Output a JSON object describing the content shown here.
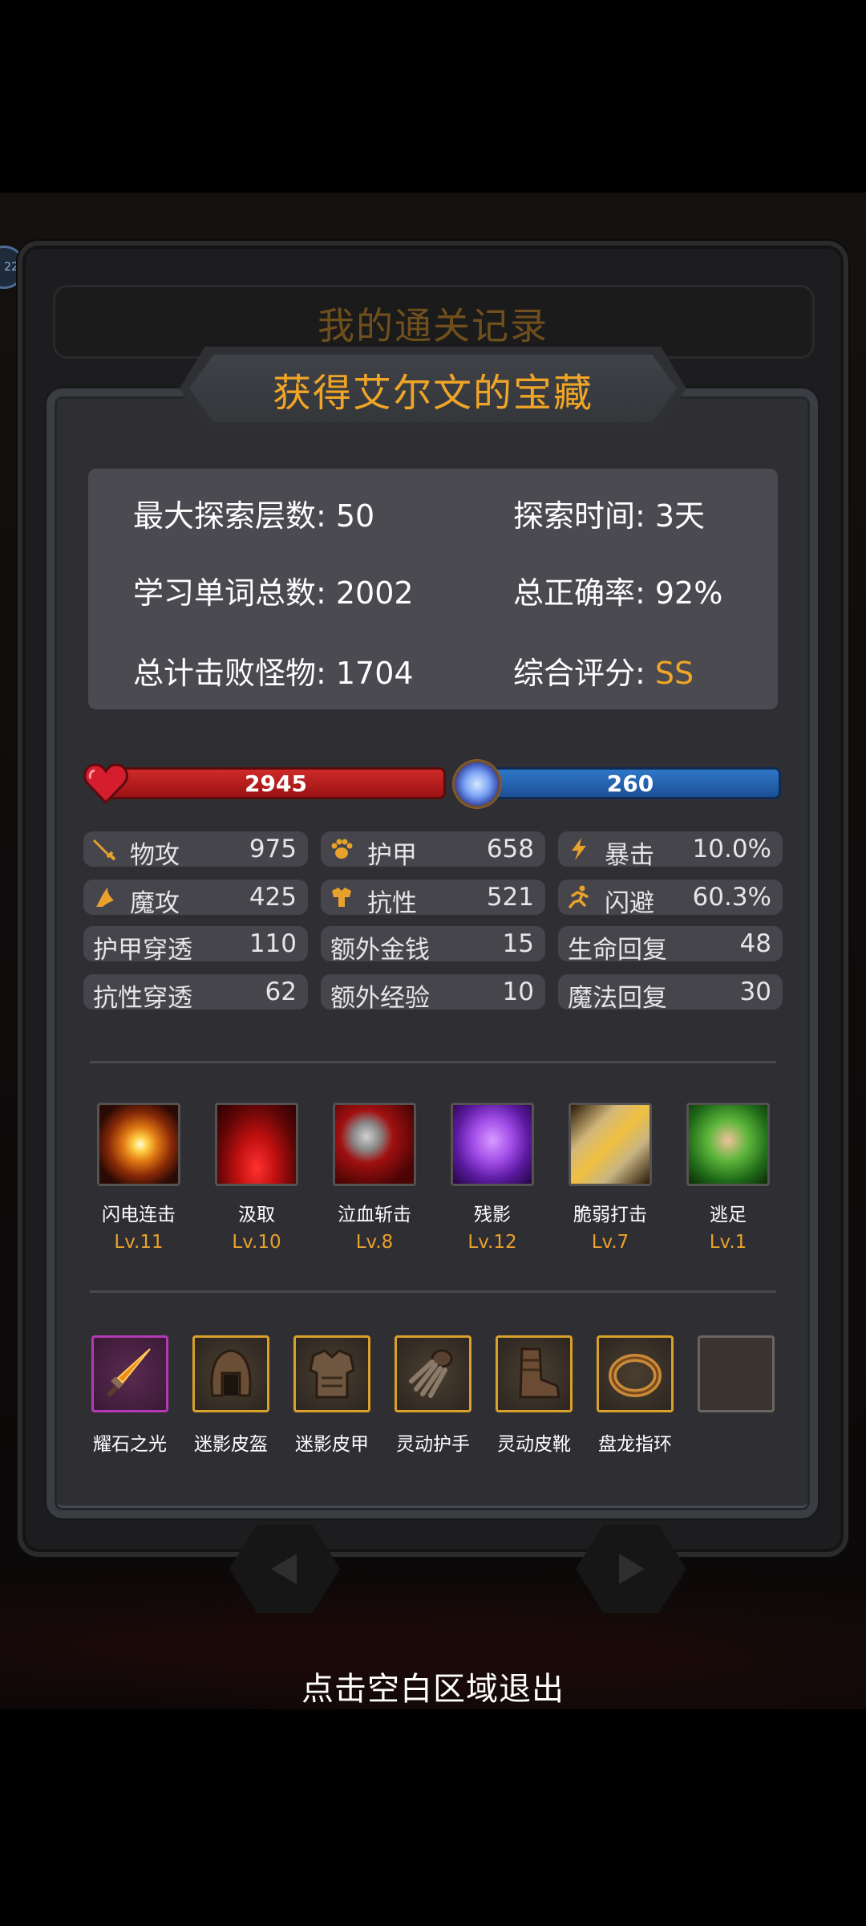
{
  "side_badge": "22",
  "back_title": "我的通关记录",
  "title": "获得艾尔文的宝藏",
  "summary": {
    "max_floor": "最大探索层数: 50",
    "explore_time": "探索时间: 3天",
    "words_total": "学习单词总数: 2002",
    "accuracy": "总正确率: 92%",
    "monsters": "总计击败怪物: 1704",
    "rating_label": "综合评分: ",
    "rating_value": "SS"
  },
  "hp": "2945",
  "mp": "260",
  "stats": [
    {
      "label": "物攻",
      "value": "975",
      "icon": "sword-icon"
    },
    {
      "label": "护甲",
      "value": "658",
      "icon": "paw-icon"
    },
    {
      "label": "暴击",
      "value": "10.0%",
      "icon": "lightning-icon"
    },
    {
      "label": "魔攻",
      "value": "425",
      "icon": "magic-hat-icon"
    },
    {
      "label": "抗性",
      "value": "521",
      "icon": "armor-icon"
    },
    {
      "label": "闪避",
      "value": "60.3%",
      "icon": "running-icon"
    },
    {
      "label": "护甲穿透",
      "value": "110"
    },
    {
      "label": "额外金钱",
      "value": "15"
    },
    {
      "label": "生命回复",
      "value": "48"
    },
    {
      "label": "抗性穿透",
      "value": "62"
    },
    {
      "label": "额外经验",
      "value": "10"
    },
    {
      "label": "魔法回复",
      "value": "30"
    }
  ],
  "skills": [
    {
      "name": "闪电连击",
      "level": "Lv.11",
      "icon": "lightning-strike-icon"
    },
    {
      "name": "汲取",
      "level": "Lv.10",
      "icon": "blood-drain-icon"
    },
    {
      "name": "泣血斩击",
      "level": "Lv.8",
      "icon": "bloody-axe-icon"
    },
    {
      "name": "残影",
      "level": "Lv.12",
      "icon": "shadow-figure-icon"
    },
    {
      "name": "脆弱打击",
      "level": "Lv.7",
      "icon": "broken-bone-icon"
    },
    {
      "name": "逃足",
      "level": "Lv.1",
      "icon": "winged-foot-icon"
    }
  ],
  "equipment": [
    {
      "name": "耀石之光",
      "icon": "dagger-icon",
      "rarity": "#b43ab4"
    },
    {
      "name": "迷影皮盔",
      "icon": "helmet-icon",
      "rarity": "#d9a12b"
    },
    {
      "name": "迷影皮甲",
      "icon": "chest-armor-icon",
      "rarity": "#d9a12b"
    },
    {
      "name": "灵动护手",
      "icon": "gauntlet-icon",
      "rarity": "#d9a12b"
    },
    {
      "name": "灵动皮靴",
      "icon": "boots-icon",
      "rarity": "#d9a12b"
    },
    {
      "name": "盘龙指环",
      "icon": "ring-icon",
      "rarity": "#d9a12b"
    },
    {
      "name": "",
      "icon": "empty-slot-icon",
      "rarity": "#6a6561"
    }
  ],
  "exit_hint": "点击空白区域退出",
  "colors": {
    "gold": "#f0a526",
    "hp": "#c82020",
    "mp": "#2a6fc0"
  }
}
